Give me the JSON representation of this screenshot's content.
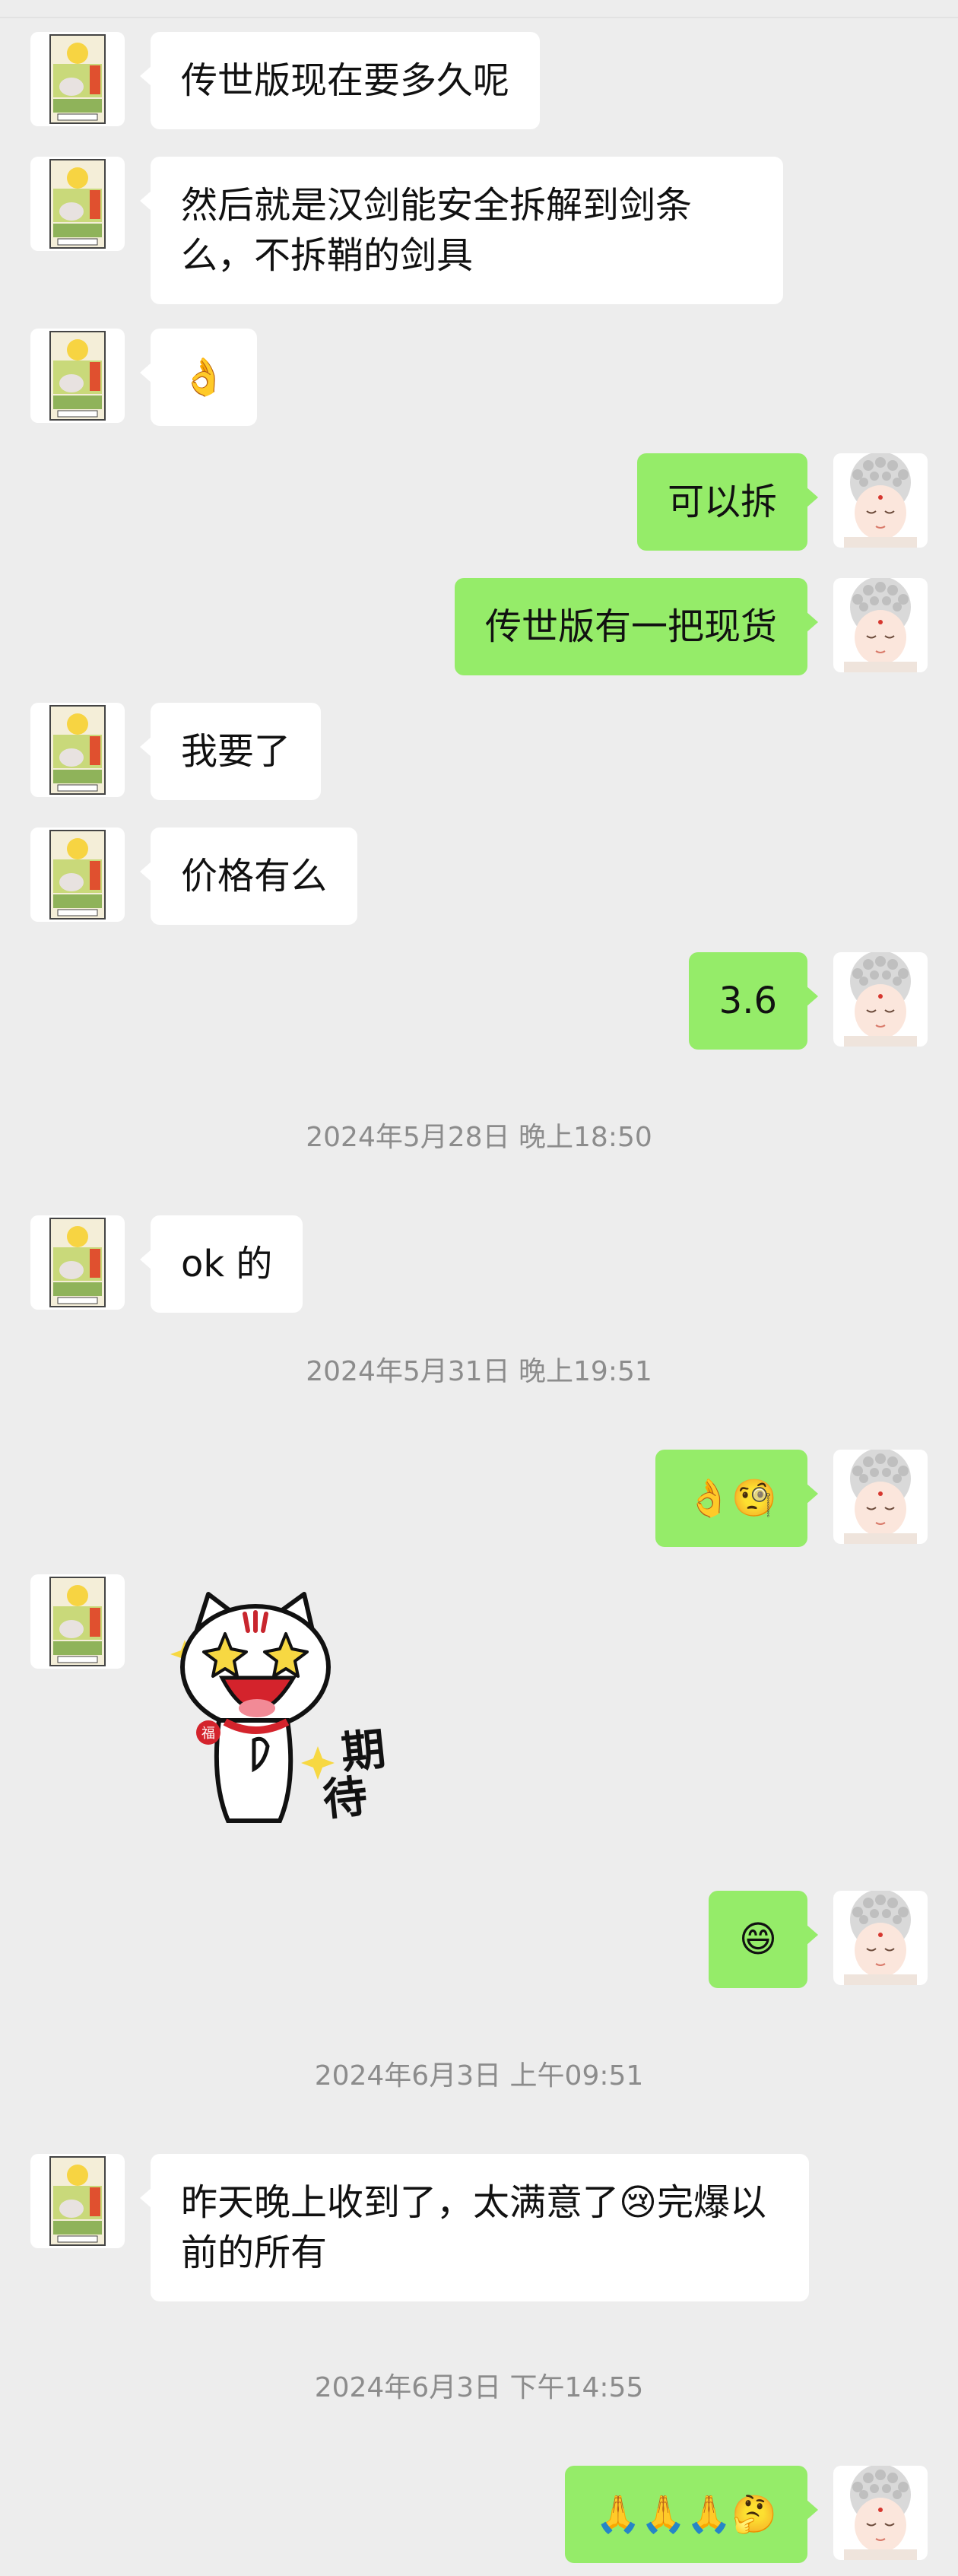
{
  "chat": {
    "messages": [
      {
        "side": "left",
        "text": "传世版现在要多久呢"
      },
      {
        "side": "left",
        "text": "然后就是汉剑能安全拆解到剑条么，不拆鞘的剑具"
      },
      {
        "side": "left",
        "text": "👌"
      },
      {
        "side": "right",
        "text": "可以拆"
      },
      {
        "side": "right",
        "text": "传世版有一把现货"
      },
      {
        "side": "left",
        "text": "我要了"
      },
      {
        "side": "left",
        "text": "价格有么"
      },
      {
        "side": "right",
        "text": "3.6"
      },
      {
        "type": "time",
        "text": "2024年5月28日 晚上18:50"
      },
      {
        "side": "left",
        "text": "ok 的"
      },
      {
        "type": "time",
        "text": "2024年5月31日 晚上19:51"
      },
      {
        "side": "right",
        "text": "👌🧐"
      },
      {
        "side": "left",
        "type": "sticker",
        "text": "期待"
      },
      {
        "side": "right",
        "text": "😄"
      },
      {
        "type": "time",
        "text": "2024年6月3日 上午09:51"
      },
      {
        "side": "left",
        "text": "昨天晚上收到了，太满意了😢完爆以前的所有"
      },
      {
        "type": "time",
        "text": "2024年6月3日 下午14:55"
      },
      {
        "side": "right",
        "text": "🙏🙏🙏🤔"
      }
    ]
  },
  "colors": {
    "background": "#ededed",
    "bubble_self": "#95ec69",
    "bubble_other": "#ffffff",
    "timestamp": "#8c8c8c"
  },
  "icons": {
    "left_avatar": "tarot-card-avatar",
    "right_avatar": "buddha-cartoon-avatar",
    "sticker": "cat-sticker-icon"
  }
}
